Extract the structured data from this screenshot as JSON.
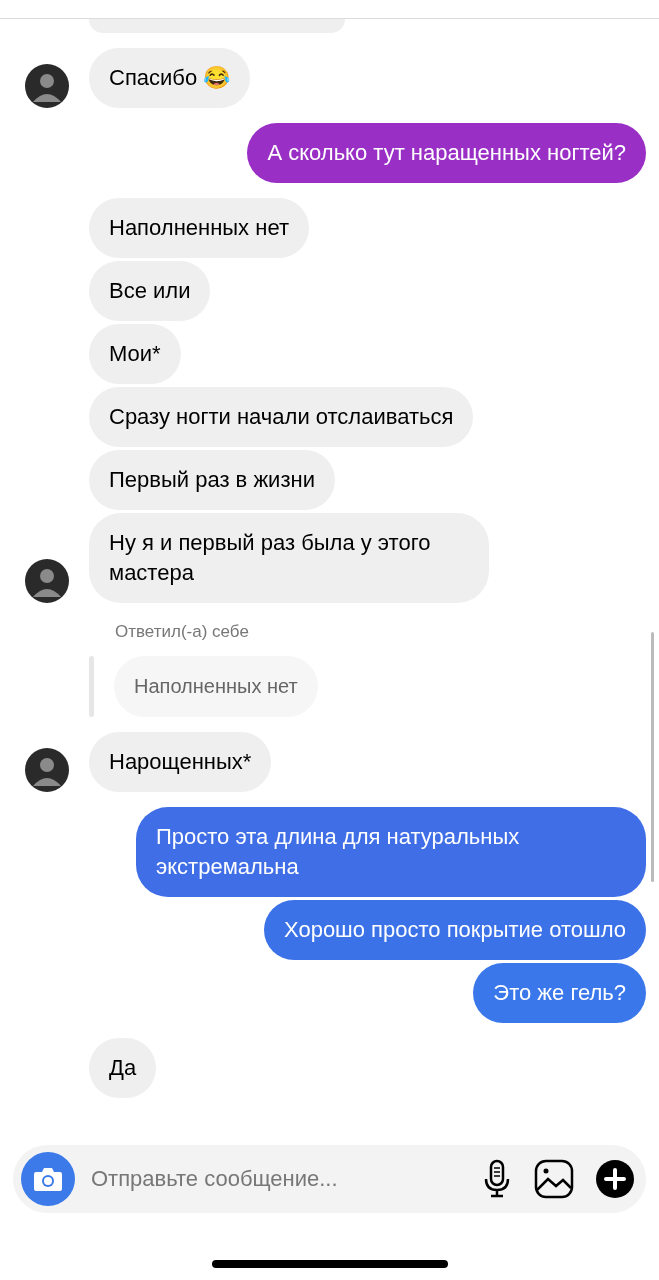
{
  "messages": [
    {
      "kind": "incoming",
      "text": "Спасибо 😂",
      "avatar": true
    },
    {
      "kind": "outgoing",
      "text": "А сколько тут наращенных ногтей?",
      "color": "#9a2fc6"
    },
    {
      "kind": "incoming",
      "text": "Наполненных нет",
      "avatar": false
    },
    {
      "kind": "incoming",
      "text": "Все или",
      "avatar": false
    },
    {
      "kind": "incoming",
      "text": "Мои*",
      "avatar": false
    },
    {
      "kind": "incoming",
      "text": "Сразу ногти начали отслаиваться",
      "avatar": false
    },
    {
      "kind": "incoming",
      "text": "Первый раз в жизни",
      "avatar": false
    },
    {
      "kind": "incoming",
      "text": "Ну я и первый раз была у этого мастера",
      "avatar": true
    },
    {
      "kind": "reply",
      "label": "Ответил(-а) себе",
      "quote": "Наполненных нет"
    },
    {
      "kind": "incoming",
      "text": "Нарощенных*",
      "avatar": true
    },
    {
      "kind": "outgoing",
      "text": "Просто эта длина для натуральных экстремальна",
      "color": "#3f6ee6"
    },
    {
      "kind": "outgoing",
      "text": "Хорошо просто покрытие отошло",
      "color": "#3c72e8"
    },
    {
      "kind": "outgoing",
      "text": "Это же гель?",
      "color": "#3a77ea"
    },
    {
      "kind": "incoming",
      "text": "Да",
      "avatar": false
    }
  ],
  "composer": {
    "placeholder": "Отправьте сообщение..."
  }
}
